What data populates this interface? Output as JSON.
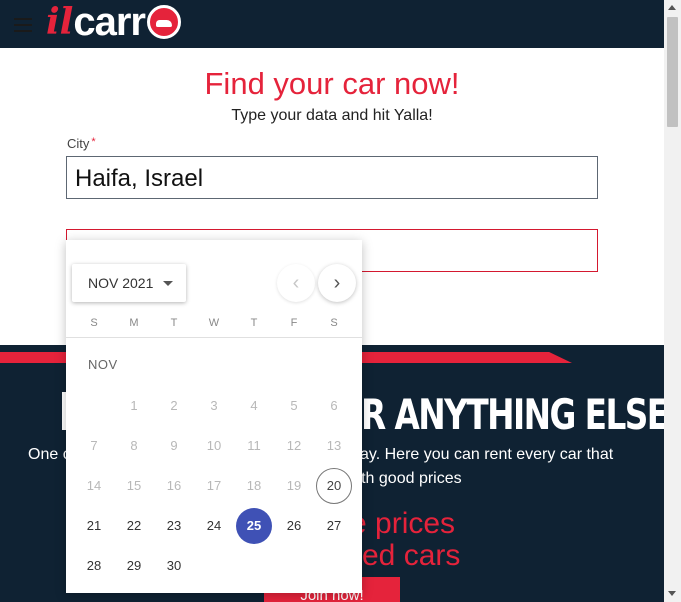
{
  "header": {
    "logo_il": "il",
    "logo_carr": "carr",
    "logo_icon": "car-o-icon",
    "menu_icon": "hamburger-icon"
  },
  "search": {
    "title": "Find your car now!",
    "subtitle": "Type your data and hit Yalla!",
    "city_label": "City",
    "city_required_mark": "*",
    "city_value": "Haifa, Israel",
    "dates_value": ""
  },
  "calendar": {
    "month_year": "NOV 2021",
    "month_label": "NOV",
    "prev_icon": "chevron-left-icon",
    "next_icon": "chevron-right-icon",
    "weekdays": [
      "S",
      "M",
      "T",
      "W",
      "T",
      "F",
      "S"
    ],
    "today": 20,
    "selected": 25,
    "days": [
      1,
      2,
      3,
      4,
      5,
      6,
      7,
      8,
      9,
      10,
      11,
      12,
      13,
      14,
      15,
      16,
      17,
      18,
      19,
      20,
      21,
      22,
      23,
      24,
      25,
      26,
      27,
      28,
      29,
      30
    ]
  },
  "banner": {
    "heading": "R ANYTHING ELSE",
    "text_left": "One c",
    "text_right": "liday. Here you can rent every car that",
    "text_line2": "with good prices",
    "promo_line1": "e prices",
    "promo_line2": "ed cars",
    "join_button": "Join now!"
  },
  "colors": {
    "brand_red": "#e5233b",
    "navy": "#0f2233",
    "selected_blue": "#3f51b5"
  }
}
